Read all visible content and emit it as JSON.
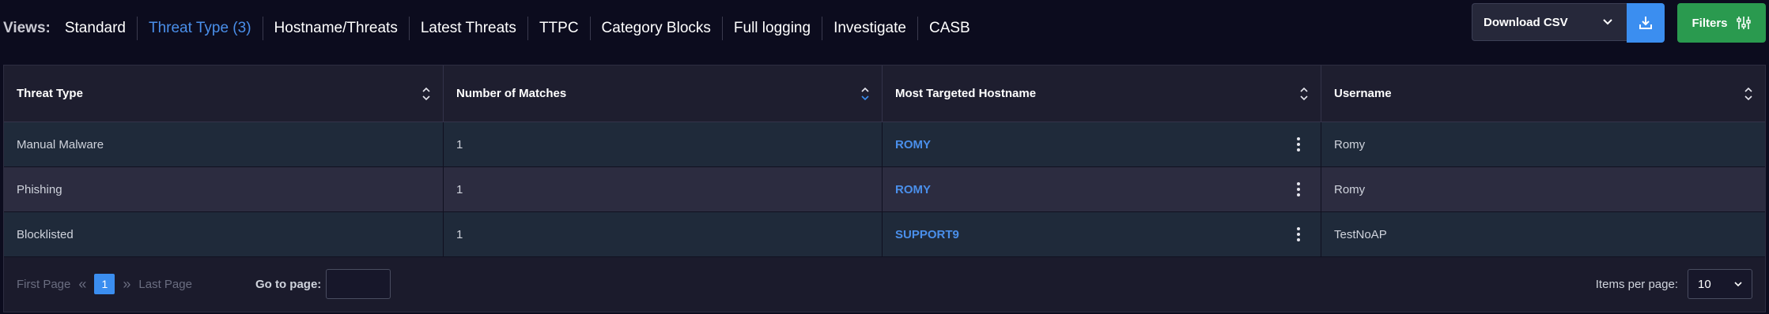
{
  "views": {
    "label": "Views:",
    "items": [
      {
        "label": "Standard",
        "active": false
      },
      {
        "label": "Threat Type (3)",
        "active": true
      },
      {
        "label": "Hostname/Threats",
        "active": false
      },
      {
        "label": "Latest Threats",
        "active": false
      },
      {
        "label": "TTPC",
        "active": false
      },
      {
        "label": "Category Blocks",
        "active": false
      },
      {
        "label": "Full logging",
        "active": false
      },
      {
        "label": "Investigate",
        "active": false
      },
      {
        "label": "CASB",
        "active": false
      }
    ]
  },
  "actions": {
    "download_label": "Download CSV",
    "filters_label": "Filters"
  },
  "table": {
    "columns": [
      "Threat Type",
      "Number of Matches",
      "Most Targeted Hostname",
      "Username"
    ],
    "rows": [
      {
        "threat_type": "Manual Malware",
        "matches": "1",
        "hostname": "ROMY",
        "username": "Romy"
      },
      {
        "threat_type": "Phishing",
        "matches": "1",
        "hostname": "ROMY",
        "username": "Romy"
      },
      {
        "threat_type": "Blocklisted",
        "matches": "1",
        "hostname": "SUPPORT9",
        "username": "TestNoAP"
      }
    ]
  },
  "pagination": {
    "first_label": "First Page",
    "current_page": "1",
    "last_label": "Last Page",
    "goto_label": "Go to page:",
    "goto_value": "",
    "items_per_page_label": "Items per page:",
    "items_per_page_value": "10"
  },
  "colors": {
    "accent": "#3b8ef0",
    "filters": "#2a9a4f",
    "link": "#4a8fea"
  }
}
